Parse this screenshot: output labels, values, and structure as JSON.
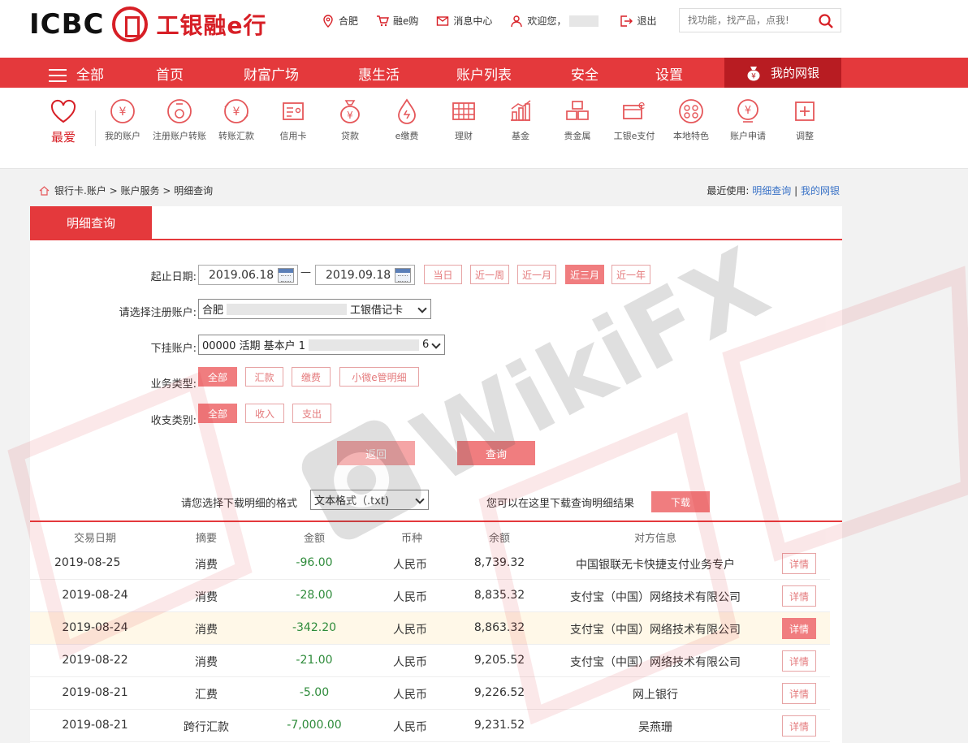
{
  "header": {
    "logo_text": "ICBC",
    "logo_cn": "工银融e行",
    "links": [
      {
        "name": "location",
        "label": "合肥"
      },
      {
        "name": "shop",
        "label": "融e购"
      },
      {
        "name": "messages",
        "label": "消息中心"
      },
      {
        "name": "user",
        "label": "欢迎您，"
      },
      {
        "name": "logout",
        "label": "退出"
      }
    ],
    "search_placeholder": "找功能，找产品，点我!"
  },
  "nav": {
    "all": "全部",
    "items": [
      "首页",
      "财富广场",
      "惠生活",
      "账户列表",
      "安全",
      "设置"
    ],
    "mybank": "我的网银"
  },
  "icons": {
    "fav": "最爱",
    "items": [
      {
        "icon": "yen-circle-icon",
        "label": "我的账户"
      },
      {
        "icon": "register-account-icon",
        "label": "注册账户转账"
      },
      {
        "icon": "transfer-icon",
        "label": "转账汇款"
      },
      {
        "icon": "credit-card-icon",
        "label": "信用卡"
      },
      {
        "icon": "money-bag-icon",
        "label": "贷款"
      },
      {
        "icon": "drop-icon",
        "label": "e缴费"
      },
      {
        "icon": "abacus-icon",
        "label": "理财"
      },
      {
        "icon": "chart-icon",
        "label": "基金"
      },
      {
        "icon": "gold-icon",
        "label": "贵金属"
      },
      {
        "icon": "epay-icon",
        "label": "工银e支付"
      },
      {
        "icon": "local-icon",
        "label": "本地特色"
      },
      {
        "icon": "apply-icon",
        "label": "账户申请"
      },
      {
        "icon": "plus-box-icon",
        "label": "调整"
      }
    ]
  },
  "breadcrumb": {
    "path": "银行卡.账户 > 账户服务 > 明细查询"
  },
  "recent": {
    "label": "最近使用:",
    "link1": "明细查询",
    "sep": "|",
    "link2": "我的网银"
  },
  "panel": {
    "tab": "明细查询",
    "date_label": "起止日期:",
    "date_from": "2019.06.18",
    "date_dash": "—",
    "date_to": "2019.09.18",
    "quick": [
      "当日",
      "近一周",
      "近一月",
      "近三月",
      "近一年"
    ],
    "account_label": "请选择注册账户:",
    "account_value_a": "合肥",
    "account_value_b": "工银借记卡",
    "sub_label": "下挂账户:",
    "sub_value_a": "00000 活期 基本户 1",
    "sub_value_b": "6",
    "biz_label": "业务类型:",
    "biz": [
      "全部",
      "汇款",
      "缴费",
      "小微e管明细"
    ],
    "io_label": "收支类别:",
    "io": [
      "全部",
      "收入",
      "支出"
    ],
    "back_btn": "返回",
    "query_btn": "查询",
    "format_label": "请您选择下载明细的格式",
    "format_value": "文本格式（.txt)",
    "download_hint": "您可以在这里下载查询明细结果",
    "download_btn": "下载"
  },
  "table": {
    "headers": [
      "交易日期",
      "摘要",
      "金额",
      "币种",
      "余额",
      "对方信息"
    ],
    "detail_label": "详情",
    "rows": [
      {
        "date": "2019-08-25",
        "summary": "消费",
        "amount": "-96.00",
        "currency": "人民币",
        "balance": "8,739.32",
        "party": "中国银联无卡快捷支付业务专户"
      },
      {
        "date": "2019-08-24",
        "summary": "消费",
        "amount": "-28.00",
        "currency": "人民币",
        "balance": "8,835.32",
        "party": "支付宝（中国）网络技术有限公司"
      },
      {
        "date": "2019-08-24",
        "summary": "消费",
        "amount": "-342.20",
        "currency": "人民币",
        "balance": "8,863.32",
        "party": "支付宝（中国）网络技术有限公司"
      },
      {
        "date": "2019-08-22",
        "summary": "消费",
        "amount": "-21.00",
        "currency": "人民币",
        "balance": "9,205.52",
        "party": "支付宝（中国）网络技术有限公司"
      },
      {
        "date": "2019-08-21",
        "summary": "汇费",
        "amount": "-5.00",
        "currency": "人民币",
        "balance": "9,226.52",
        "party": "网上银行"
      },
      {
        "date": "2019-08-21",
        "summary": "跨行汇款",
        "amount": "-7,000.00",
        "currency": "人民币",
        "balance": "9,231.52",
        "party": "吴燕珊"
      }
    ]
  },
  "watermark": "WikiFX",
  "colors": {
    "brand_red": "#e4393c",
    "nav_dark": "#b81c22",
    "btn_pink": "#f07d7f",
    "amount_green": "#2e8b3a",
    "link_blue": "#3a73c7"
  }
}
